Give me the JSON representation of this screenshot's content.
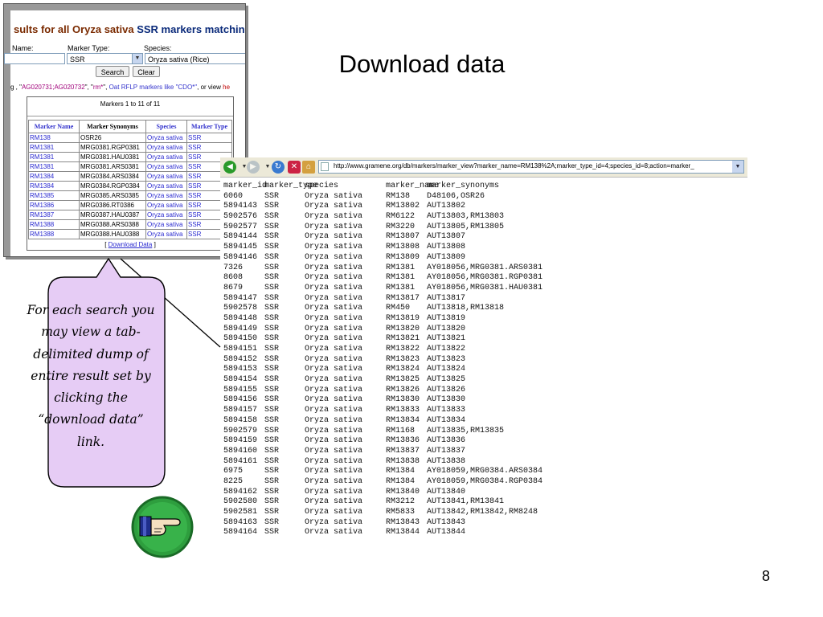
{
  "slide": {
    "title": "Download data",
    "number": "8",
    "callout": "For each search you may view a tab-delimited dump of entire result set by clicking the “download data” link."
  },
  "search_page": {
    "heading_prefix": "sults for all Oryza sativa ",
    "heading_highlight": "SSR markers matching",
    "form": {
      "name_label": "Name:",
      "marker_type_label": "Marker Type:",
      "species_label": "Species:",
      "marker_type_value": "SSR",
      "species_value": "Oryza sativa (Rice)"
    },
    "search_button": "Search",
    "clear_button": "Clear",
    "examples": {
      "prefix": "g , \"",
      "ex1": "AG020731;AG020732",
      "mid1": "\", \"",
      "ex2": "rm*",
      "mid2": "\", ",
      "ex3": "Oat RFLP markers like \"CDO*\"",
      "mid3": ", or view ",
      "ex4": "he"
    },
    "caption": "Markers 1 to 11 of 11",
    "columns": [
      "Marker Name",
      "Marker Synonyms",
      "Species",
      "Marker Type"
    ],
    "rows": [
      [
        "RM138",
        "OSR26",
        "Oryza sativa",
        "SSR"
      ],
      [
        "RM1381",
        "MRG0381.RGP0381",
        "Oryza sativa",
        "SSR"
      ],
      [
        "RM1381",
        "MRG0381.HAU0381",
        "Oryza sativa",
        "SSR"
      ],
      [
        "RM1381",
        "MRG0381.ARS0381",
        "Oryza sativa",
        "SSR"
      ],
      [
        "RM1384",
        "MRG0384.ARS0384",
        "Oryza sativa",
        "SSR"
      ],
      [
        "RM1384",
        "MRG0384.RGP0384",
        "Oryza sativa",
        "SSR"
      ],
      [
        "RM1385",
        "MRG0385.ARS0385",
        "Oryza sativa",
        "SSR"
      ],
      [
        "RM1386",
        "MRG0386.RT0386",
        "Oryza sativa",
        "SSR"
      ],
      [
        "RM1387",
        "MRG0387.HAU0387",
        "Oryza sativa",
        "SSR"
      ],
      [
        "RM1388",
        "MRG0388.ARS0388",
        "Oryza sativa",
        "SSR"
      ],
      [
        "RM1388",
        "MRG0388.HAU0388",
        "Oryza sativa",
        "SSR"
      ]
    ],
    "download_link": "Download Data"
  },
  "browser": {
    "url": "http://www.gramene.org/db/markers/marker_view?marker_name=RM138%2A;marker_type_id=4;species_id=8;action=marker_",
    "icons": [
      "back-icon",
      "forward-icon",
      "refresh-icon",
      "stop-icon",
      "home-icon"
    ],
    "header": [
      "marker_id",
      "marker_type",
      "species",
      "marker_name",
      "marker_synonyms"
    ],
    "rows": [
      [
        "6060",
        "SSR",
        "Oryza sativa",
        "RM138",
        "D48106,OSR26"
      ],
      [
        "5894143",
        "SSR",
        "Oryza sativa",
        "RM13802",
        "AUT13802"
      ],
      [
        "5902576",
        "SSR",
        "Oryza sativa",
        "RM6122",
        "AUT13803,RM13803"
      ],
      [
        "5902577",
        "SSR",
        "Oryza sativa",
        "RM3220",
        "AUT13805,RM13805"
      ],
      [
        "5894144",
        "SSR",
        "Oryza sativa",
        "RM13807",
        "AUT13807"
      ],
      [
        "5894145",
        "SSR",
        "Oryza sativa",
        "RM13808",
        "AUT13808"
      ],
      [
        "5894146",
        "SSR",
        "Oryza sativa",
        "RM13809",
        "AUT13809"
      ],
      [
        "7326",
        "SSR",
        "Oryza sativa",
        "RM1381",
        "AY018056,MRG0381.ARS0381"
      ],
      [
        "8608",
        "SSR",
        "Oryza sativa",
        "RM1381",
        "AY018056,MRG0381.RGP0381"
      ],
      [
        "8679",
        "SSR",
        "Oryza sativa",
        "RM1381",
        "AY018056,MRG0381.HAU0381"
      ],
      [
        "5894147",
        "SSR",
        "Oryza sativa",
        "RM13817",
        "AUT13817"
      ],
      [
        "5902578",
        "SSR",
        "Oryza sativa",
        "RM450",
        "AUT13818,RM13818"
      ],
      [
        "5894148",
        "SSR",
        "Oryza sativa",
        "RM13819",
        "AUT13819"
      ],
      [
        "5894149",
        "SSR",
        "Oryza sativa",
        "RM13820",
        "AUT13820"
      ],
      [
        "5894150",
        "SSR",
        "Oryza sativa",
        "RM13821",
        "AUT13821"
      ],
      [
        "5894151",
        "SSR",
        "Oryza sativa",
        "RM13822",
        "AUT13822"
      ],
      [
        "5894152",
        "SSR",
        "Oryza sativa",
        "RM13823",
        "AUT13823"
      ],
      [
        "5894153",
        "SSR",
        "Oryza sativa",
        "RM13824",
        "AUT13824"
      ],
      [
        "5894154",
        "SSR",
        "Oryza sativa",
        "RM13825",
        "AUT13825"
      ],
      [
        "5894155",
        "SSR",
        "Oryza sativa",
        "RM13826",
        "AUT13826"
      ],
      [
        "5894156",
        "SSR",
        "Oryza sativa",
        "RM13830",
        "AUT13830"
      ],
      [
        "5894157",
        "SSR",
        "Oryza sativa",
        "RM13833",
        "AUT13833"
      ],
      [
        "5894158",
        "SSR",
        "Oryza sativa",
        "RM13834",
        "AUT13834"
      ],
      [
        "5902579",
        "SSR",
        "Oryza sativa",
        "RM1168",
        "AUT13835,RM13835"
      ],
      [
        "5894159",
        "SSR",
        "Oryza sativa",
        "RM13836",
        "AUT13836"
      ],
      [
        "5894160",
        "SSR",
        "Oryza sativa",
        "RM13837",
        "AUT13837"
      ],
      [
        "5894161",
        "SSR",
        "Oryza sativa",
        "RM13838",
        "AUT13838"
      ],
      [
        "6975",
        "SSR",
        "Oryza sativa",
        "RM1384",
        "AY018059,MRG0384.ARS0384"
      ],
      [
        "8225",
        "SSR",
        "Oryza sativa",
        "RM1384",
        "AY018059,MRG0384.RGP0384"
      ],
      [
        "5894162",
        "SSR",
        "Oryza sativa",
        "RM13840",
        "AUT13840"
      ],
      [
        "5902580",
        "SSR",
        "Oryza sativa",
        "RM3212",
        "AUT13841,RM13841"
      ],
      [
        "5902581",
        "SSR",
        "Oryza sativa",
        "RM5833",
        "AUT13842,RM13842,RM8248"
      ],
      [
        "5894163",
        "SSR",
        "Oryza sativa",
        "RM13843",
        "AUT13843"
      ],
      [
        "5894164",
        "SSR",
        "Oryza sativa",
        "RM13844",
        "AUT13844"
      ]
    ]
  },
  "colors": {
    "callout_fill": "#e6ccf5",
    "pointer_green": "#2e9e3e"
  },
  "pointer_icon": "hand-pointer-icon"
}
